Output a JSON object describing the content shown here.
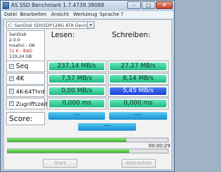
{
  "window": {
    "title": "AS SSD Benchmark 1.7.4739.38088",
    "min_label": "–",
    "max_label": "□",
    "close_label": "✕"
  },
  "menu": [
    "Datei",
    "Bearbeiten",
    "Ansicht",
    "Werkzeug",
    "Sprache",
    "?"
  ],
  "drive_select": {
    "value": "C: SanDisk SDSSDP128G ATA Device",
    "arrow": "▾"
  },
  "drive_info": {
    "name": "SanDisk",
    "firmware": "2.0.0",
    "driver": "msahci - OK",
    "alignment": "31 K - BAD",
    "size": "119,24 GB"
  },
  "columns": {
    "read": "Lesen:",
    "write": "Schreiben:"
  },
  "rows": [
    {
      "label": "Seq",
      "checked": true,
      "read": "237,14 MB/s",
      "write": "27,27 MB/s"
    },
    {
      "label": "4K",
      "checked": true,
      "read": "7,57 MB/s",
      "write": "8,14 MB/s"
    },
    {
      "label": "4K-64Thrd",
      "checked": true,
      "read": "0,00 MB/s",
      "write": "5,45 MB/s"
    },
    {
      "label": "Zugriffszeit",
      "checked": true,
      "read": "0,000 ms",
      "write": "0,000 ms"
    }
  ],
  "check_mark": "✓",
  "score": {
    "label": "Score:",
    "read": "----",
    "write": "----",
    "total": "----"
  },
  "progress": {
    "time": "00:00:29",
    "top_fraction": 0.74,
    "bottom_fraction": 0.76
  },
  "buttons": {
    "start": "Start",
    "abort": "Abbrechen"
  },
  "colors": {
    "bar_green": "#2fd29a",
    "bar_blue": "#2a4fe6",
    "score_blue": "#2aa6e6"
  }
}
